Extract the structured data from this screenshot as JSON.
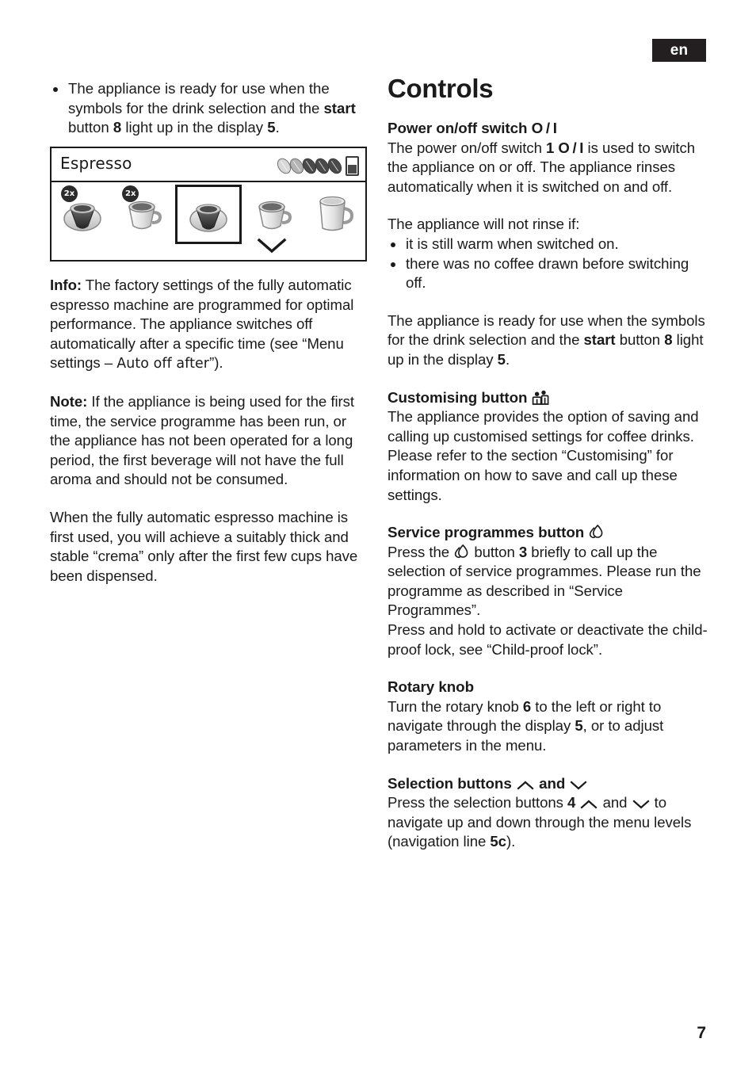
{
  "page": {
    "language_badge": "en",
    "page_number": "7"
  },
  "left_column": {
    "intro_bullet": {
      "part1": "The appliance is ready for use when the symbols for the drink selection and the ",
      "bold_start": "start",
      "part2": " button ",
      "bold_8": "8",
      "part3": " light up in the display ",
      "bold_5": "5",
      "part4": "."
    },
    "display_figure": {
      "title": "Espresso",
      "strength_beans": [
        "light",
        "light",
        "dark",
        "dark",
        "dark"
      ],
      "cup_level_icon": "cup-fill-icon",
      "drinks": [
        {
          "name": "espresso-double",
          "badge": "2x",
          "selected": false,
          "type": "small-cup"
        },
        {
          "name": "coffee-double",
          "badge": "2x",
          "selected": false,
          "type": "cup"
        },
        {
          "name": "espresso",
          "badge": "",
          "selected": true,
          "type": "small-cup"
        },
        {
          "name": "coffee",
          "badge": "",
          "selected": false,
          "type": "cup"
        },
        {
          "name": "large-coffee",
          "badge": "",
          "selected": false,
          "type": "mug"
        }
      ],
      "scroll_icon": "chevron-down-icon"
    },
    "info_paragraph": {
      "label": "Info:",
      "text_before": " The factory settings of the fully automatic espresso machine are programmed for optimal performance. The appliance switches off automatically after a specific time (see “Menu settings – ",
      "menu_item": "Auto off after",
      "text_after": "”)."
    },
    "note_paragraph": {
      "label": "Note:",
      "text": " If the appliance is being used for the first time, the service programme has been run, or the appliance has not been operated for a long period, the first beverage will not have the full aroma and should not be consumed."
    },
    "crema_paragraph": "When the fully automatic espresso machine is first used, you will achieve a suitably thick and stable “crema” only after the first few cups have been dispensed."
  },
  "right_column": {
    "heading": "Controls",
    "sections": [
      {
        "id": "power-switch",
        "title": "Power on/off switch O / I",
        "title_text": "Power on/off switch",
        "title_symbol": "O / I",
        "body_1_a": "The power on/off switch ",
        "body_1_b": "1 O / I",
        "body_1_c": " is used to switch the appliance on or off. The appliance rinses automatically when it is switched on and off.",
        "body_2": "The appliance will not rinse if:",
        "bullets": [
          "it is still warm when switched on.",
          "there was no coffee drawn before switching off."
        ],
        "body_3_a": "The appliance is ready for use when the symbols for the drink selection and the ",
        "body_3_b": "start",
        "body_3_c": " button ",
        "body_3_d": "8",
        "body_3_e": " light up in the display ",
        "body_3_f": "5",
        "body_3_g": "."
      },
      {
        "id": "customising-button",
        "title_text": "Customising button",
        "title_icon": "people-icon",
        "body": "The appliance provides the option of saving and calling up customised settings for coffee drinks. Please refer to the section “Customising” for information on how to save and call up these settings."
      },
      {
        "id": "service-programmes-button",
        "title_text": "Service programmes button",
        "title_icon": "droplet-icon",
        "body_a": "Press the ",
        "body_icon": "droplet-icon",
        "body_b": " button ",
        "body_c": "3",
        "body_d": " briefly to call up the selection of service programmes. Please run the programme as described in “Service Programmes”.",
        "body_e": "Press and hold to activate or deactivate the child-proof lock, see “Child-proof lock”."
      },
      {
        "id": "rotary-knob",
        "title_text": "Rotary knob",
        "body_a": "Turn the rotary knob ",
        "body_b": "6",
        "body_c": " to the left or right to navigate through the display ",
        "body_d": "5",
        "body_e": ", or to adjust parameters in the menu."
      },
      {
        "id": "selection-buttons",
        "title_text": "Selection buttons",
        "title_and": "and",
        "title_icon_up": "chevron-up-icon",
        "title_icon_down": "chevron-down-icon",
        "body_a": "Press the selection buttons ",
        "body_b": "4",
        "body_and": " and ",
        "body_c": " to navigate up and down through the menu levels (navigation line ",
        "body_d": "5c",
        "body_e": ")."
      }
    ]
  },
  "colors": {
    "text": "#1a1a1a",
    "badge_bg": "#231f20",
    "badge_text": "#ffffff",
    "bean_dark": "#4a4a4a",
    "bean_light": "#d8d8d8"
  }
}
